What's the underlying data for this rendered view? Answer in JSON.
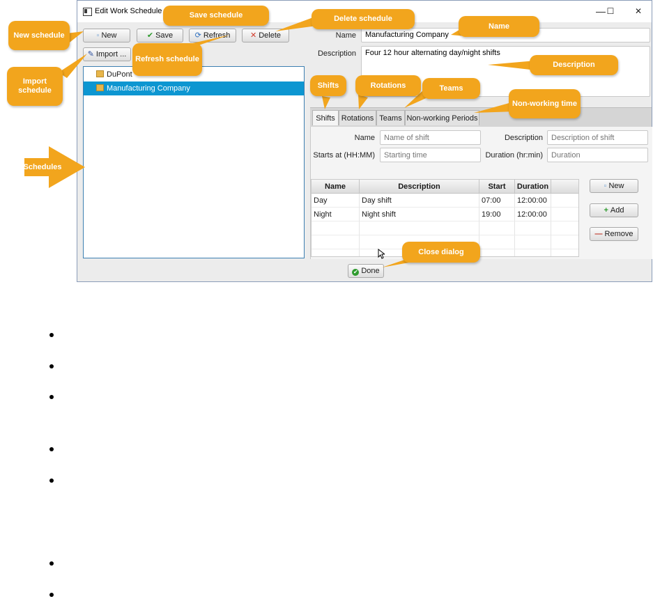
{
  "window": {
    "title": "Edit Work Schedule",
    "controls": {
      "minimize": "—",
      "maximize": "☐",
      "close": "✕"
    }
  },
  "toolbar": {
    "new_label": "New",
    "save_label": "Save",
    "refresh_label": "Refresh",
    "delete_label": "Delete",
    "import_label": "Import ..."
  },
  "schedules": {
    "items": [
      {
        "label": "DuPont",
        "selected": false
      },
      {
        "label": "Manufacturing Company",
        "selected": true
      }
    ]
  },
  "details": {
    "name_label": "Name",
    "name_value": "Manufacturing Company",
    "description_label": "Description",
    "description_value": "Four 12 hour alternating day/night shifts"
  },
  "tabs": [
    {
      "label": "Shifts",
      "active": true
    },
    {
      "label": "Rotations",
      "active": false
    },
    {
      "label": "Teams",
      "active": false
    },
    {
      "label": "Non-working Periods",
      "active": false
    }
  ],
  "shift_form": {
    "name_label": "Name",
    "name_placeholder": "Name of shift",
    "description_label": "Description",
    "description_placeholder": "Description of shift",
    "start_label": "Starts at (HH:MM)",
    "start_placeholder": "Starting time",
    "duration_label": "Duration (hr:min)",
    "duration_placeholder": "Duration"
  },
  "shift_table": {
    "columns": [
      "Name",
      "Description",
      "Start",
      "Duration"
    ],
    "rows": [
      [
        "Day",
        "Day shift",
        "07:00",
        "12:00:00"
      ],
      [
        "Night",
        "Night shift",
        "19:00",
        "12:00:00"
      ]
    ]
  },
  "shift_buttons": {
    "new_label": "New",
    "add_label": "Add",
    "remove_label": "Remove"
  },
  "footer": {
    "done_label": "Done"
  },
  "callouts": {
    "new_schedule": "New schedule",
    "save_schedule": "Save schedule",
    "delete_schedule": "Delete schedule",
    "name": "Name",
    "refresh_schedule": "Refresh schedule",
    "import_schedule": "Import schedule",
    "description": "Description",
    "shifts": "Shifts",
    "rotations": "Rotations",
    "teams": "Teams",
    "non_working_time": "Non-working time",
    "schedules": "Schedules",
    "close_dialog": "Close dialog"
  },
  "colors": {
    "accent_selection": "#0d96d1",
    "callout": "#f2a51d",
    "list_border": "#3c7fb1"
  }
}
